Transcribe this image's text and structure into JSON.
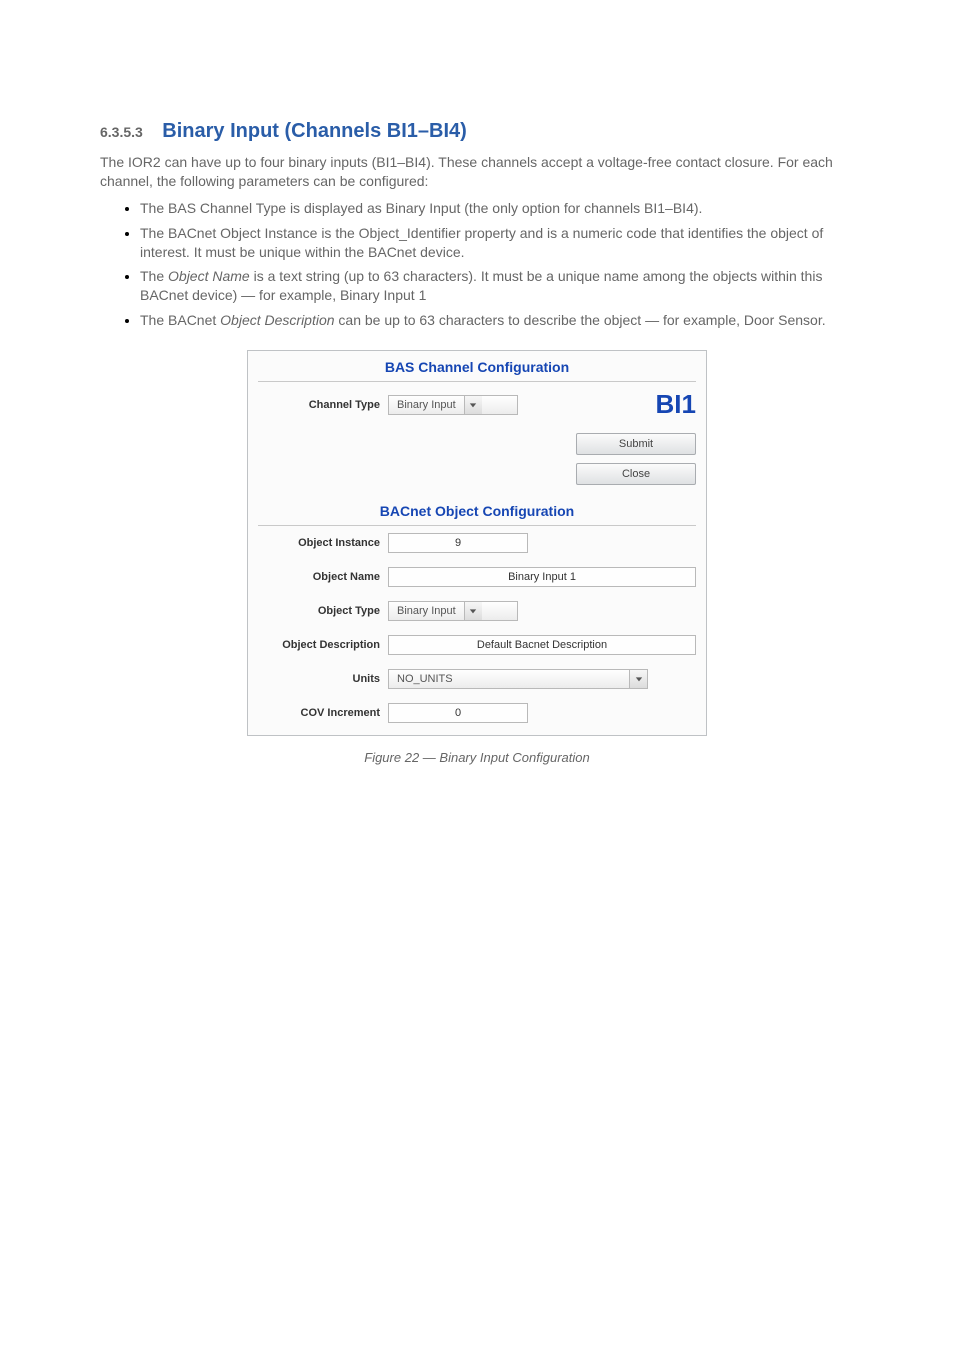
{
  "section": {
    "number": "6.3.5.3",
    "title_prefix": "Binary Input ",
    "title_suffix": ")",
    "channels": "(Channels BI1–BI4"
  },
  "intro": "The IOR2 can have up to four binary inputs (BI1–BI4). These channels accept a voltage-free contact closure. For each channel, the following parameters can be configured:",
  "bullets": [
    {
      "text": "The BAS Channel Type is displayed as Binary Input (the only option for channels BI1–BI4)."
    },
    {
      "text": "The BACnet Object Instance is the Object_Identifier property and is a numeric code that identifies the object of interest. It must be unique within the BACnet device."
    },
    {
      "pre": "The ",
      "em": "Object Name",
      "post": " is a text string (up to 63 characters). It must be a unique name among the objects within this BACnet device) — for example, Binary Input 1"
    },
    {
      "pre": "The BACnet ",
      "em": "Object Description",
      "post": " can be up to 63 characters to describe the object — for example, Door Sensor."
    }
  ],
  "panel": {
    "bas_title": "BAS Channel Configuration",
    "bacnet_title": "BACnet Object Configuration",
    "channel_type_label": "Channel Type",
    "channel_type_value": "Binary Input",
    "channel_id": "BI1",
    "submit": "Submit",
    "close": "Close",
    "obj_instance_label": "Object Instance",
    "obj_instance_value": "9",
    "obj_name_label": "Object Name",
    "obj_name_value": "Binary Input 1",
    "obj_type_label": "Object Type",
    "obj_type_value": "Binary Input",
    "obj_desc_label": "Object Description",
    "obj_desc_value": "Default Bacnet Description",
    "units_label": "Units",
    "units_value": "NO_UNITS",
    "cov_label": "COV Increment",
    "cov_value": "0"
  },
  "figure": {
    "caption_pre": "Figure 22 ",
    "dash": "—",
    "caption_post": " Binary Input Configuration"
  }
}
